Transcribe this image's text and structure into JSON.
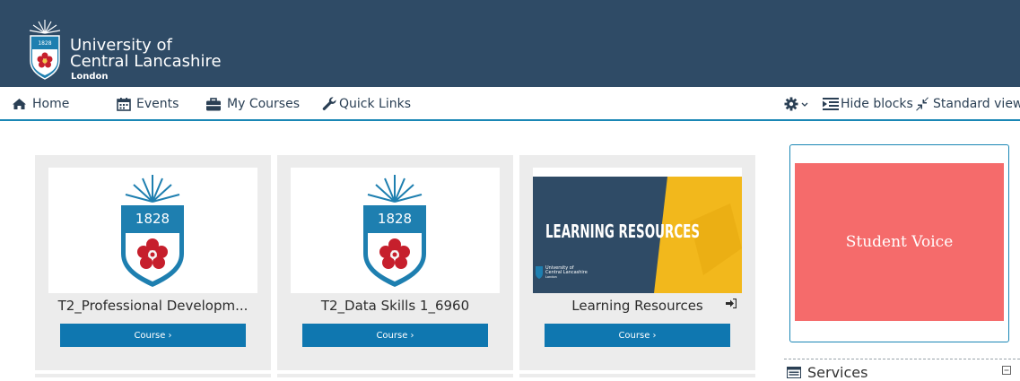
{
  "header": {
    "logo_year": "1828",
    "university_line1": "University of",
    "university_line2": "Central Lancashire",
    "university_sub": "London"
  },
  "nav": {
    "home": "Home",
    "events": "Events",
    "my_courses": "My Courses",
    "quick_links": "Quick Links",
    "hide_blocks": "Hide blocks",
    "standard_view": "Standard view"
  },
  "courses": [
    {
      "title": "T2_Professional Developm...",
      "button": "Course ›",
      "image_year": "1828"
    },
    {
      "title": "T2_Data Skills 1_6960",
      "button": "Course ›",
      "image_year": "1828"
    },
    {
      "title": "Learning Resources",
      "button": "Course ›",
      "image_heading": "LEARNING RESOURCES",
      "image_logo_line1": "University of",
      "image_logo_line2": "Central Lancashire",
      "image_logo_line3": "London"
    }
  ],
  "sidebar": {
    "student_voice": "Student Voice",
    "services": "Services"
  },
  "colors": {
    "header_bg": "#2f4b66",
    "accent": "#1a87b5",
    "button_bg": "#0f77b0",
    "student_voice_bg": "#f56b6b",
    "shield_blue": "#1e7fb0",
    "rose_red": "#c61f2c"
  }
}
